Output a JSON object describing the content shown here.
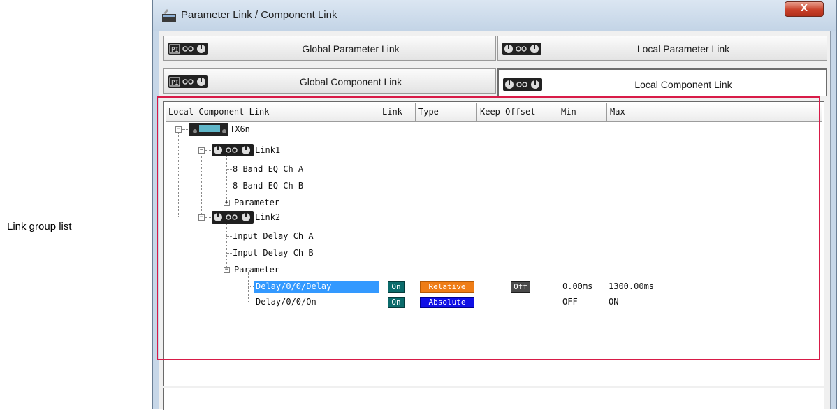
{
  "callout": {
    "label": "Link group list"
  },
  "window": {
    "title": "Parameter Link / Component Link",
    "close_label": "X"
  },
  "tabs": [
    {
      "label": "Global Parameter Link",
      "icon": "global-link-icon"
    },
    {
      "label": "Local Parameter Link",
      "icon": "link-icon"
    },
    {
      "label": "Global Component Link",
      "icon": "global-link-icon"
    },
    {
      "label": "Local Component Link",
      "icon": "link-icon",
      "active": true
    }
  ],
  "columns": [
    "Local Component Link",
    "Link",
    "Type",
    "Keep Offset",
    "Min",
    "Max"
  ],
  "tree": {
    "device": "TX6n",
    "link1": {
      "name": "Link1",
      "children": [
        "8 Band EQ  Ch A",
        "8 Band EQ  Ch B",
        "Parameter"
      ]
    },
    "link2": {
      "name": "Link2",
      "children": [
        "Input Delay  Ch A",
        "Input Delay  Ch B",
        "Parameter"
      ],
      "parameters": [
        {
          "name": "Delay/0/0/Delay",
          "link": "On",
          "type": "Relative",
          "keep_offset": "Off",
          "min": "0.00ms",
          "max": "1300.00ms",
          "selected": true
        },
        {
          "name": "Delay/0/0/On",
          "link": "On",
          "type": "Absolute",
          "min": "OFF",
          "max": "ON"
        }
      ]
    }
  },
  "colors": {
    "highlight": "#d81b48",
    "selection": "#3399ff",
    "relative": "#ef7d16",
    "absolute": "#1010e6",
    "on": "#0b6b6b"
  }
}
